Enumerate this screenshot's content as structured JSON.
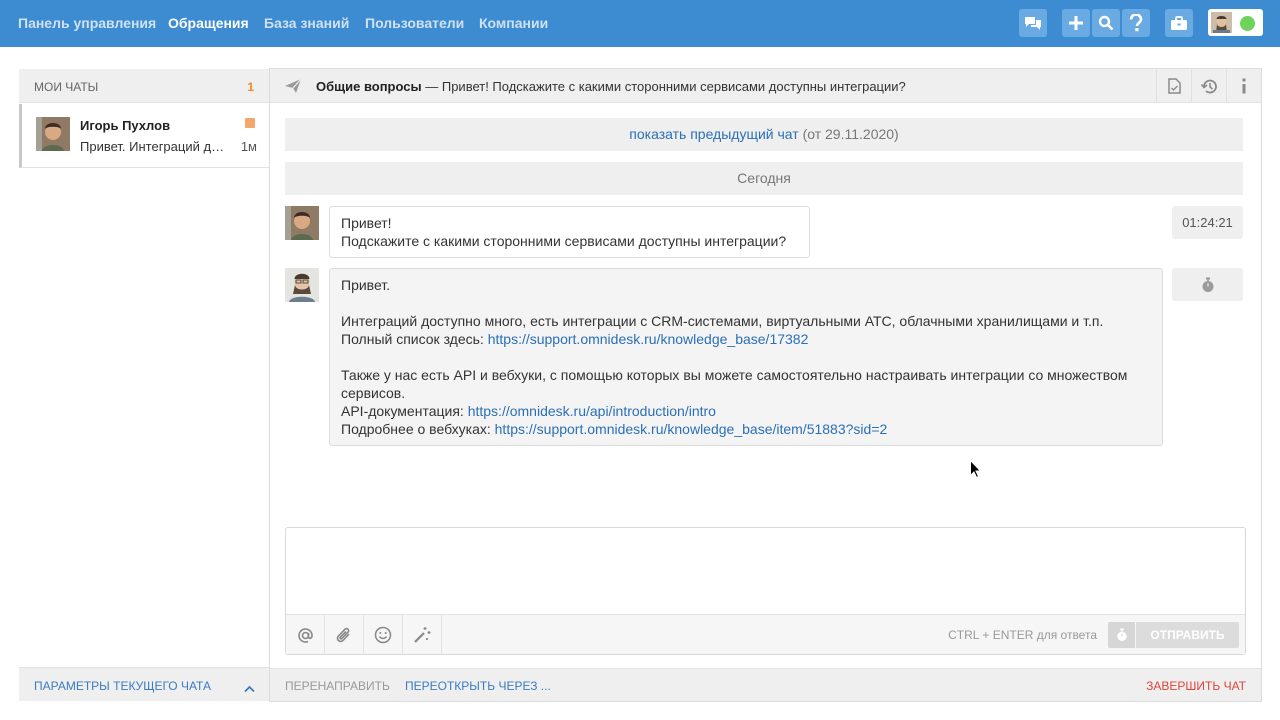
{
  "nav": {
    "items": [
      "Панель управления",
      "Обращения",
      "База знаний",
      "Пользователи",
      "Компании"
    ]
  },
  "icons": {
    "chat": "chat-bubbles-icon",
    "add": "plus-icon",
    "search": "search-icon",
    "help": "question-icon",
    "briefcase": "briefcase-icon"
  },
  "colors": {
    "topbar": "#3d8cd1",
    "link": "#2a6fb7",
    "counter": "#f08a24",
    "danger": "#e0453b",
    "online": "#6dd35a"
  },
  "sidebar": {
    "title": "МОИ ЧАТЫ",
    "count": "1",
    "chat": {
      "name": "Игорь Пухлов",
      "preview": "Привет. Интеграций доступно много",
      "time": "1м"
    },
    "footer": "ПАРАМЕТРЫ ТЕКУЩЕГО ЧАТА"
  },
  "chat_header": {
    "group": "Общие вопросы",
    "separator": "—",
    "subject": "Привет! Подскажите с какими сторонними сервисами доступны интеграции?"
  },
  "history": {
    "link": "показать предыдущий чат",
    "date": "(от 29.11.2020)",
    "day": "Сегодня"
  },
  "messages": {
    "client": {
      "line1": "Привет!",
      "line2": "Подскажите с какими сторонними сервисами доступны интеграции?",
      "time": "01:24:21"
    },
    "staff": {
      "greeting": "Привет.",
      "line1": "Интеграций доступно много, есть интеграции с CRM-системами, виртуальными АТС, облачными хранилищами и т.п.",
      "list_label": "Полный список здесь:",
      "list_url": "https://support.omnidesk.ru/knowledge_base/17382",
      "line2": "Также у нас есть API и вебхуки, с помощью которых вы можете самостоятельно настраивать интеграции со множеством сервисов.",
      "api_label": "API-документация:",
      "api_url": "https://omnidesk.ru/api/introduction/intro",
      "hooks_label": "Подробнее о вебхуках:",
      "hooks_url": "https://support.omnidesk.ru/knowledge_base/item/51883?sid=2"
    }
  },
  "composer": {
    "hint": "CTRL + ENTER для ответа",
    "send": "ОТПРАВИТЬ"
  },
  "actions": {
    "redirect": "ПЕРЕНАПРАВИТЬ",
    "reopen": "ПЕРЕОТКРЫТЬ ЧЕРЕЗ ...",
    "finish": "ЗАВЕРШИТЬ ЧАТ"
  }
}
